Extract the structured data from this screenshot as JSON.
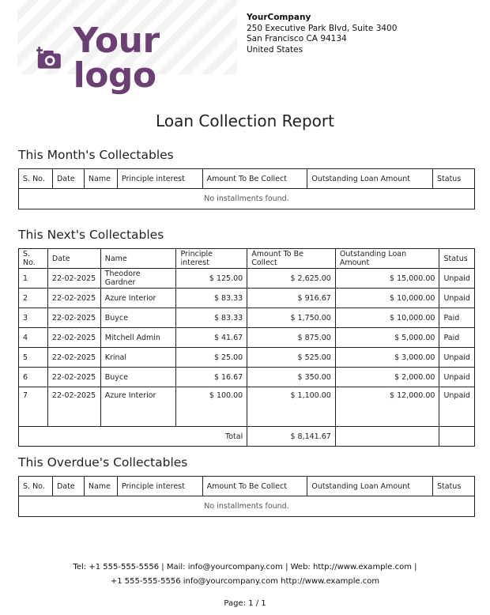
{
  "logo": {
    "text": "Your logo",
    "icon": "camera-plus-icon",
    "color": "#6b3f73"
  },
  "company": {
    "name": "YourCompany",
    "address1": "250 Executive Park Blvd, Suite 3400",
    "address2": "San Francisco CA 94134",
    "country": "United States"
  },
  "report_title": "Loan Collection Report",
  "headers": [
    "S. No.",
    "Date",
    "Name",
    "Principle interest",
    "Amount To Be Collect",
    "Outstanding Loan Amount",
    "Status"
  ],
  "this_month": {
    "title": "This Month's Collectables",
    "empty": "No installments found."
  },
  "next": {
    "title": "This Next's Collectables",
    "rows": [
      [
        "1",
        "22-02-2025",
        "Theodore Gardner",
        "$ 125.00",
        "$ 2,625.00",
        "$ 15,000.00",
        "Unpaid"
      ],
      [
        "2",
        "22-02-2025",
        "Azure Interior",
        "$ 83.33",
        "$ 916.67",
        "$ 10,000.00",
        "Unpaid"
      ],
      [
        "3",
        "22-02-2025",
        "Buyce",
        "$ 83.33",
        "$ 1,750.00",
        "$ 10,000.00",
        "Paid"
      ],
      [
        "4",
        "22-02-2025",
        "Mitchell Admin",
        "$ 41.67",
        "$ 875.00",
        "$ 5,000.00",
        "Paid"
      ],
      [
        "5",
        "22-02-2025",
        "Krinal",
        "$ 25.00",
        "$ 525.00",
        "$ 3,000.00",
        "Unpaid"
      ],
      [
        "6",
        "22-02-2025",
        "Buyce",
        "$ 16.67",
        "$ 350.00",
        "$ 2,000.00",
        "Unpaid"
      ],
      [
        "7",
        "22-02-2025",
        "Azure Interior",
        "$ 100.00",
        "$ 1,100.00",
        "$ 12,000.00",
        "Unpaid"
      ]
    ],
    "total_label": "Total",
    "total_value": "$ 8,141.67"
  },
  "overdue": {
    "title": "This Overdue's Collectables",
    "empty": "No installments found."
  },
  "footer": {
    "line1": "Tel: +1 555-555-5556 |   Mail: info@yourcompany.com |   Web: http://www.example.com |",
    "line2": "+1 555-555-5556 info@yourcompany.com http://www.example.com",
    "page": "Page: 1 / 1"
  }
}
